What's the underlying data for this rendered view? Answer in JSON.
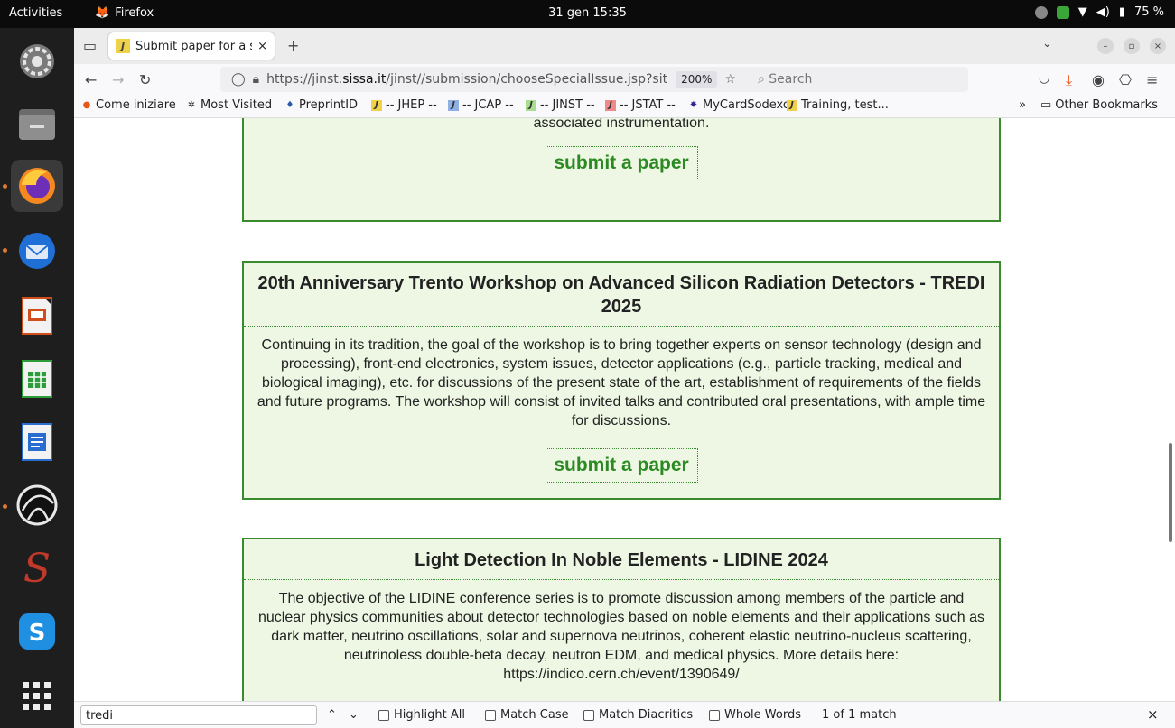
{
  "system": {
    "activities": "Activities",
    "app_name": "Firefox",
    "clock": "31 gen 15:35",
    "battery": "75 %"
  },
  "browser": {
    "tab_title": "Submit paper for a s",
    "url_prefix": "https://jinst.",
    "url_domain": "sissa.it",
    "url_path": "/jinst//submission/chooseSpecialIssue.jsp?sit",
    "zoom": "200%",
    "search_placeholder": "Search",
    "bookmarks": [
      {
        "label": "Come iniziare"
      },
      {
        "label": "Most Visited"
      },
      {
        "label": "PreprintID"
      },
      {
        "label": "-- JHEP --"
      },
      {
        "label": "-- JCAP --"
      },
      {
        "label": "-- JINST --"
      },
      {
        "label": "-- JSTAT --"
      },
      {
        "label": "MyCardSodexo"
      },
      {
        "label": "Training, test..."
      }
    ],
    "other_bookmarks": "Other Bookmarks",
    "overflow": "»"
  },
  "page": {
    "prev_card_text": "diverse fields such as particle and astroparticle physics, nuclear physics, nuclear medicine, astronomy, and associated instrumentation.",
    "submit_label": "submit a paper",
    "cards": [
      {
        "title": "20th Anniversary Trento Workshop on Advanced Silicon Radiation Detectors  - TREDI 2025",
        "text": "Continuing in its tradition, the goal of the workshop is to bring together experts on sensor technology (design and processing), front-end electronics, system issues, detector applications (e.g., particle tracking, medical and biological imaging), etc. for discussions of the present state of the art, establishment of requirements of the fields and future programs. The workshop will consist of invited talks and contributed oral presentations, with ample time for discussions."
      },
      {
        "title": "Light Detection In Noble Elements - LIDINE 2024",
        "text": "The objective of the LIDINE conference series is to promote discussion among members of the particle and nuclear physics communities about detector technologies based on noble elements and their applications such as dark matter, neutrino oscillations, solar and supernova neutrinos, coherent elastic neutrino-nucleus scattering, neutrinoless double-beta decay, neutron EDM, and medical physics. More details here: https://indico.cern.ch/event/1390649/"
      }
    ]
  },
  "findbar": {
    "query": "tredi",
    "highlight_all": "Highlight All",
    "match_case": "Match Case",
    "match_diacritics": "Match Diacritics",
    "whole_words": "Whole Words",
    "result": "1 of 1 match"
  },
  "colors": {
    "card_bg": "#eef7e4",
    "card_border": "#3a8a2e",
    "submit_text": "#2c8a22"
  }
}
